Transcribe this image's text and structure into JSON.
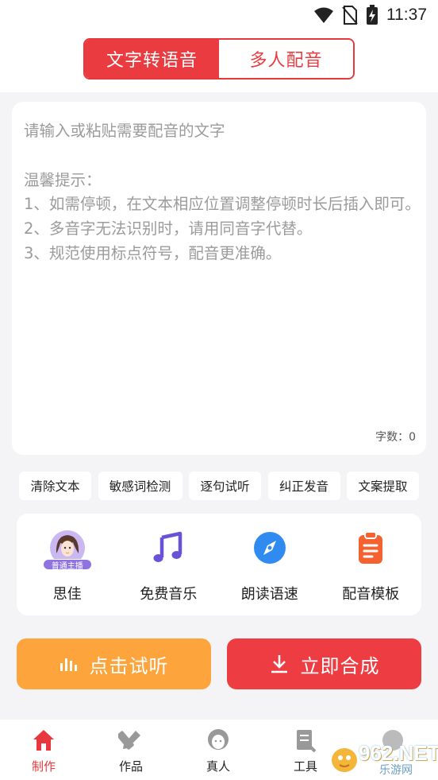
{
  "status_bar": {
    "time": "11:37",
    "icons": [
      "wifi-icon",
      "no-sim-icon",
      "battery-charging-icon"
    ]
  },
  "header": {
    "tabs": [
      {
        "label": "文字转语音",
        "active": true
      },
      {
        "label": "多人配音",
        "active": false
      }
    ]
  },
  "editor": {
    "placeholder": "请输入或粘贴需要配音的文字\n\n温馨提示：\n1、如需停顿，在文本相应位置调整停顿时长后插入即可。\n2、多音字无法识别时，请用同音字代替。\n3、规范使用标点符号，配音更准确。",
    "char_count": "字数：0"
  },
  "tools": [
    {
      "label": "清除文本"
    },
    {
      "label": "敏感词检测"
    },
    {
      "label": "逐句试听"
    },
    {
      "label": "纠正发音"
    },
    {
      "label": "文案提取"
    }
  ],
  "features": [
    {
      "label": "思佳",
      "icon": "avatar-icon",
      "badge": "普通主播"
    },
    {
      "label": "免费音乐",
      "icon": "music-note-icon"
    },
    {
      "label": "朗读语速",
      "icon": "compass-icon"
    },
    {
      "label": "配音模板",
      "icon": "clipboard-icon"
    }
  ],
  "actions": {
    "listen_label": "点击试听",
    "compose_label": "立即合成"
  },
  "tabbar": [
    {
      "label": "制作",
      "icon": "home-icon",
      "active": true
    },
    {
      "label": "作品",
      "icon": "pencil-ruler-icon",
      "active": false
    },
    {
      "label": "真人",
      "icon": "person-icon",
      "active": false
    },
    {
      "label": "工具",
      "icon": "document-tool-icon",
      "active": false
    }
  ],
  "watermark": {
    "text": "962.NET",
    "sub": "乐游网"
  },
  "colors": {
    "primary_red": "#ea3c40",
    "orange": "#fda43c",
    "page_bg": "#f4f4f6",
    "placeholder_gray": "#9b9b9b",
    "avatar_purple": "#8f74e0",
    "music_purple": "#6a52d6",
    "compass_blue": "#2f8bf0",
    "template_orange": "#f4622f"
  }
}
